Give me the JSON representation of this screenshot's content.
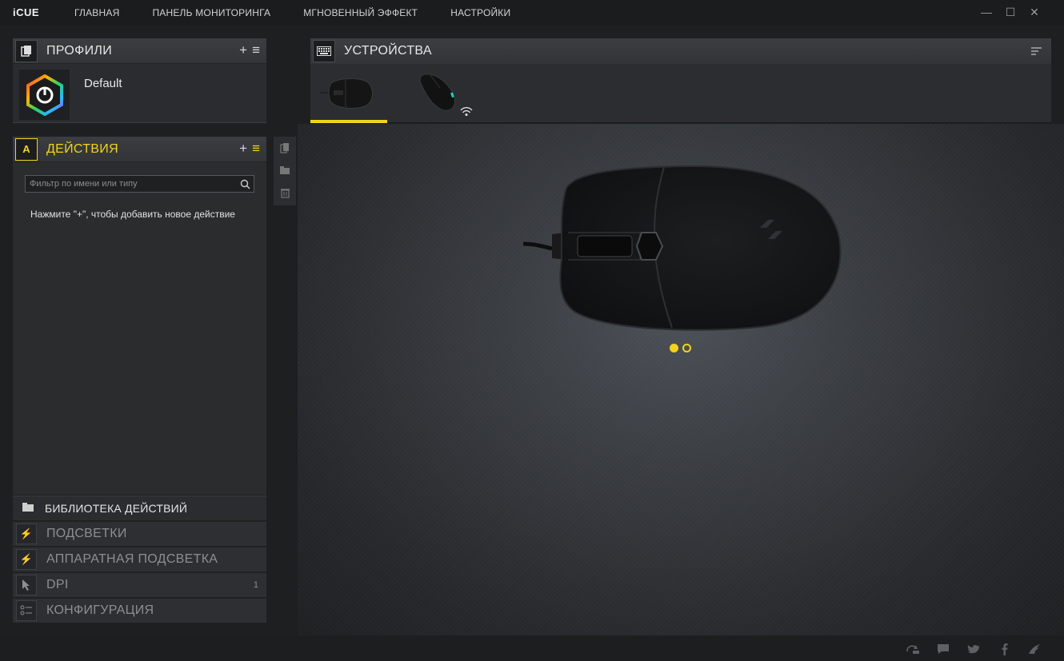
{
  "app": {
    "logo": "iCUE"
  },
  "nav": [
    "ГЛАВНАЯ",
    "ПАНЕЛЬ МОНИТОРИНГА",
    "МГНОВЕННЫЙ ЭФФЕКТ",
    "НАСТРОЙКИ"
  ],
  "window_controls": {
    "minimize": "—",
    "maximize": "☐",
    "close": "✕"
  },
  "profiles": {
    "title": "ПРОФИЛИ",
    "add": "+",
    "menu": "≡",
    "items": [
      {
        "name": "Default",
        "icon": "icue-hex-logo"
      }
    ]
  },
  "actions": {
    "title": "ДЕЙСТВИЯ",
    "title_color": "#f2d21b",
    "add": "+",
    "menu": "≡",
    "filter_placeholder": "Фильтр по имени или типу",
    "hint": "Нажмите \"+\", чтобы добавить новое действие"
  },
  "library": {
    "label": "БИБЛИОТЕКА ДЕЙСТВИЙ",
    "icon": "folder-icon"
  },
  "menu": [
    {
      "label": "ПОДСВЕТКИ",
      "icon": "lightning-icon",
      "count": ""
    },
    {
      "label": "АППАРАТНАЯ ПОДСВЕТКА",
      "icon": "lightning-icon",
      "count": ""
    },
    {
      "label": "DPI",
      "icon": "cursor-icon",
      "count": "1"
    },
    {
      "label": "КОНФИГУРАЦИЯ",
      "icon": "settings-list-icon",
      "count": ""
    }
  ],
  "devices": {
    "title": "УСТРОЙСТВА",
    "tabs": [
      {
        "name": "wired-mouse",
        "active": true
      },
      {
        "name": "wireless-mouse",
        "active": false
      }
    ],
    "pager_pages": 2,
    "pager_current": 1
  },
  "colors": {
    "accent": "#f2d21b",
    "bg": "#1e1f21",
    "panel": "#2a2c2f"
  },
  "footer_icons": [
    "update-icon",
    "chat-icon",
    "twitter-icon",
    "facebook-icon",
    "corsair-icon"
  ]
}
